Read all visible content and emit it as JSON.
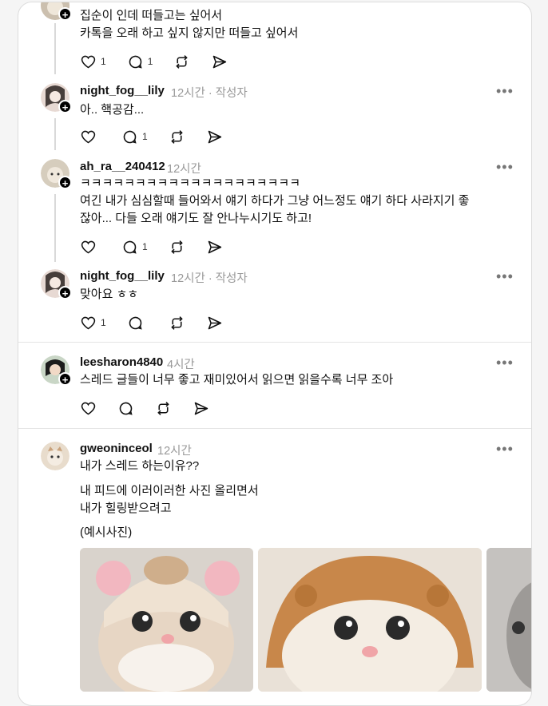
{
  "posts": [
    {
      "text": "집순이 인데 떠들고는 싶어서\n카톡을 오래 하고 싶지 않지만 떠들고 싶어서",
      "likes": "1",
      "replies": "1"
    },
    {
      "username": "night_fog__lily",
      "time": "12시간",
      "author_tag": "· 작성자",
      "text": "아.. 핵공감...",
      "likes": "",
      "replies": "1"
    },
    {
      "username": "ah_ra__240412",
      "time": "12시간",
      "text": "ㅋㅋㅋㅋㅋㅋㅋㅋㅋㅋㅋㅋㅋㅋㅋㅋㅋㅋㅋㅋ\n여긴 내가 심심할때 들어와서 얘기 하다가 그냥 어느정도 얘기 하다 사라지기 좋\n잖아... 다들 오래 얘기도 잘 안나누시기도 하고!",
      "likes": "",
      "replies": "1"
    },
    {
      "username": "night_fog__lily",
      "time": "12시간",
      "author_tag": "· 작성자",
      "text": "맞아요 ㅎㅎ",
      "likes": "1",
      "replies": ""
    },
    {
      "username": "leesharon4840",
      "time": "4시간",
      "text": "스레드 글들이 너무 좋고 재미있어서 읽으면 읽을수록 너무 조아",
      "likes": "",
      "replies": ""
    },
    {
      "username": "gweoninceol",
      "time": "12시간",
      "line1": "내가 스레드 하는이유??",
      "line2": "내 피드에 이러이러한 사진 올리면서\n내가 힐링받으려고",
      "line3": "(예시사진)"
    }
  ],
  "icons": [
    "heart-icon",
    "comment-icon",
    "repost-icon",
    "share-icon",
    "more-icon",
    "plus-icon"
  ],
  "colors": {
    "text": "#111111",
    "muted": "#999999",
    "divider": "#e5e5e5"
  }
}
